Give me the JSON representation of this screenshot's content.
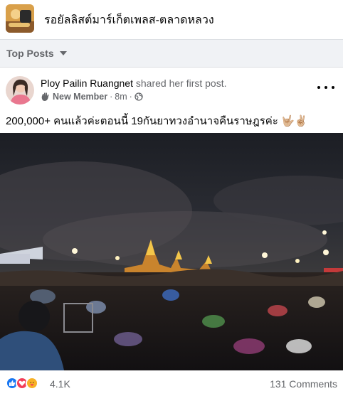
{
  "group": {
    "name": "รอยัลลิสต์มาร์เก็ตเพลส-ตลาดหลวง",
    "thumbnail_icon": "group-thumbnail"
  },
  "feed": {
    "sort_label": "Top Posts",
    "sort_icon": "caret-down-icon"
  },
  "post": {
    "author": "Ploy Pailin Ruangnet",
    "action": " shared her first post.",
    "badge": "New Member",
    "badge_icon": "wave-hand-icon",
    "time": "8m",
    "privacy_icon": "globe-icon",
    "separator": "·",
    "text": "200,000+ คนแล้วค่ะตอนนี้ 19กันยาทวงอำนาจคืนราษฎรค่ะ 🤟🏼✌🏼",
    "photo_icon": "night-rally-crowd-photo"
  },
  "reactions": {
    "icons": [
      "like-icon",
      "love-icon",
      "care-icon"
    ],
    "count": "4.1K",
    "comments": "131 Comments"
  },
  "colors": {
    "sort_bar_bg": "#f0f2f5",
    "secondary_text": "#65676b",
    "like_blue": "#1877f2",
    "love_red": "#f33e58",
    "care_yellow": "#f7b125"
  }
}
